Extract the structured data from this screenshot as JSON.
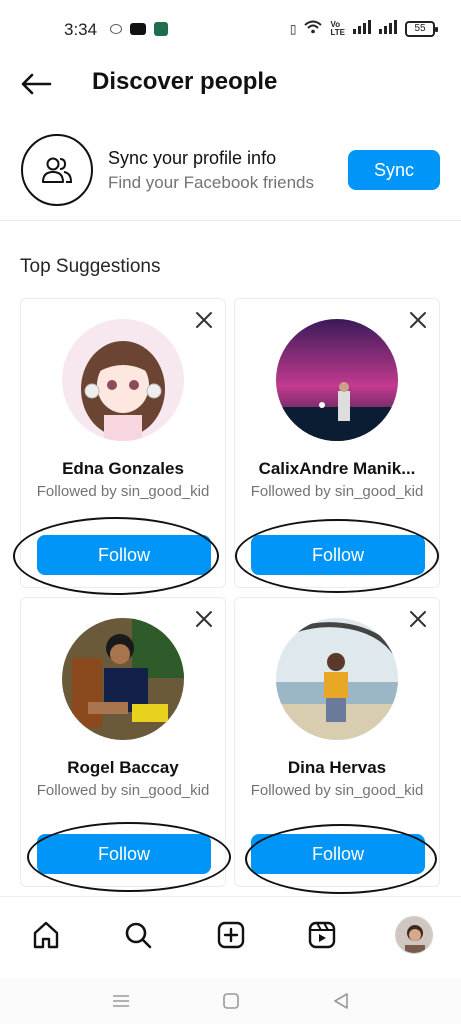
{
  "status_bar": {
    "time": "3:34",
    "battery": "55"
  },
  "header": {
    "title": "Discover people"
  },
  "sync": {
    "title": "Sync your profile info",
    "subtitle": "Find your Facebook friends",
    "button_label": "Sync"
  },
  "section_title": "Top Suggestions",
  "suggestions": [
    {
      "name": "Edna Gonzales",
      "subtitle": "Followed by sin_good_kid",
      "follow_label": "Follow"
    },
    {
      "name": "CalixAndre Manik...",
      "subtitle": "Followed by sin_good_kid",
      "follow_label": "Follow"
    },
    {
      "name": "Rogel Baccay",
      "subtitle": "Followed by sin_good_kid",
      "follow_label": "Follow"
    },
    {
      "name": "Dina Hervas",
      "subtitle": "Followed by sin_good_kid",
      "follow_label": "Follow"
    }
  ],
  "bottom_nav": [
    "home-icon",
    "search-icon",
    "create-icon",
    "reels-icon",
    "profile-avatar"
  ],
  "colors": {
    "accent": "#0095f6",
    "text": "#262626",
    "muted": "#737373"
  }
}
